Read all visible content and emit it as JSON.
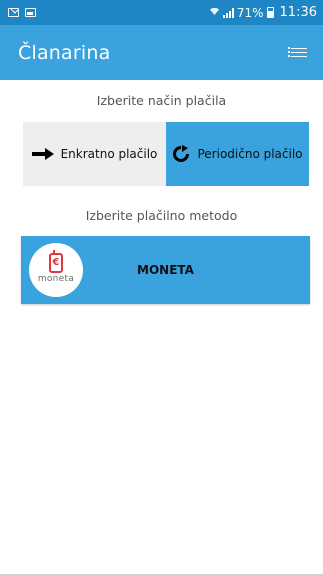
{
  "status_bar": {
    "battery_percent": "71%",
    "time": "11:36",
    "icons": [
      "gallery-icon",
      "mail-icon",
      "wifi-icon",
      "signal-icon",
      "battery-icon"
    ]
  },
  "app_bar": {
    "title": "Članarina",
    "menu_icon": "list-menu-icon"
  },
  "payment_mode": {
    "label": "Izberite način plačila",
    "options": [
      {
        "label": "Enkratno plačilo",
        "icon": "arrow-right-icon",
        "selected": false
      },
      {
        "label": "Periodično plačilo",
        "icon": "refresh-icon",
        "selected": true
      }
    ]
  },
  "payment_method": {
    "label": "Izberite plačilno metodo",
    "options": [
      {
        "label": "MONETA",
        "logo_text": "moneta",
        "logo_symbol": "€"
      }
    ]
  },
  "colors": {
    "status_bar": "#1e86c4",
    "primary": "#3aa3de",
    "unselected": "#eeeeee",
    "logo_red": "#e0373f"
  }
}
